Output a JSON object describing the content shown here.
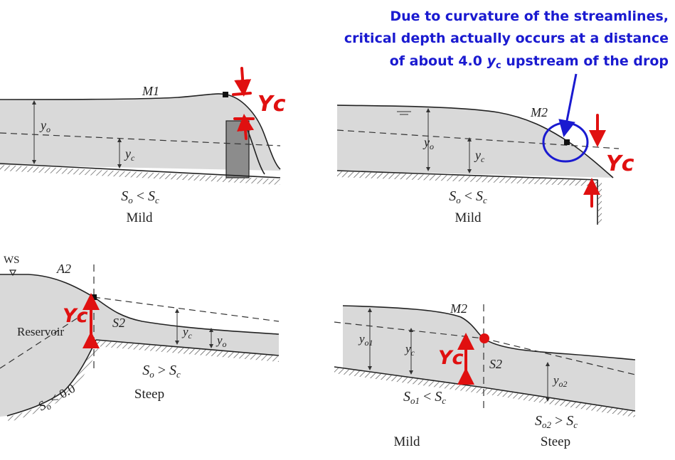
{
  "annotation": {
    "line1": "Due to curvature of the streamlines,",
    "line2": "critical depth actually occurs at a distance",
    "line3_pre": "of about 4.0 ",
    "line3_var": "y",
    "line3_sub": "c",
    "line3_post": " upstream of the drop",
    "color": "#1a1ad0"
  },
  "handwriting": {
    "text": "Yc",
    "color": "#e01010"
  },
  "panel_tl": {
    "profile": "M1",
    "yo": "y",
    "yo_sub": "o",
    "yc": "y",
    "yc_sub": "c",
    "slope": "S",
    "slope_sub": "o",
    "rel": " < ",
    "slope2": "S",
    "slope2_sub": "c",
    "type": "Mild"
  },
  "panel_tr": {
    "profile": "M2",
    "yo": "y",
    "yo_sub": "o",
    "yc": "y",
    "yc_sub": "c",
    "slope": "S",
    "slope_sub": "o",
    "rel": " < ",
    "slope2": "S",
    "slope2_sub": "c",
    "type": "Mild"
  },
  "panel_bl": {
    "ws": "WS",
    "profile1": "A2",
    "profile2": "S2",
    "reservoir": "Reservoir",
    "yc": "y",
    "yc_sub": "c",
    "yo": "y",
    "yo_sub": "o",
    "slope": "S",
    "slope_sub": "o",
    "rel": " > ",
    "slope2": "S",
    "slope2_sub": "c",
    "res_slope": "S",
    "res_slope_sub": "o",
    "res_rel": " < 0.0",
    "type": "Steep"
  },
  "panel_br": {
    "profile1": "M2",
    "profile2": "S2",
    "yo1": "y",
    "yo1_sub": "o1",
    "yc": "y",
    "yc_sub": "c",
    "yo2": "y",
    "yo2_sub": "o2",
    "slope1": "S",
    "slope1_sub": "o1",
    "rel1": " < ",
    "slope1b": "S",
    "slope1b_sub": "c",
    "slope2": "S",
    "slope2_sub": "o2",
    "rel2": " > ",
    "slope2b": "S",
    "slope2b_sub": "c",
    "type1": "Mild",
    "type2": "Steep"
  }
}
